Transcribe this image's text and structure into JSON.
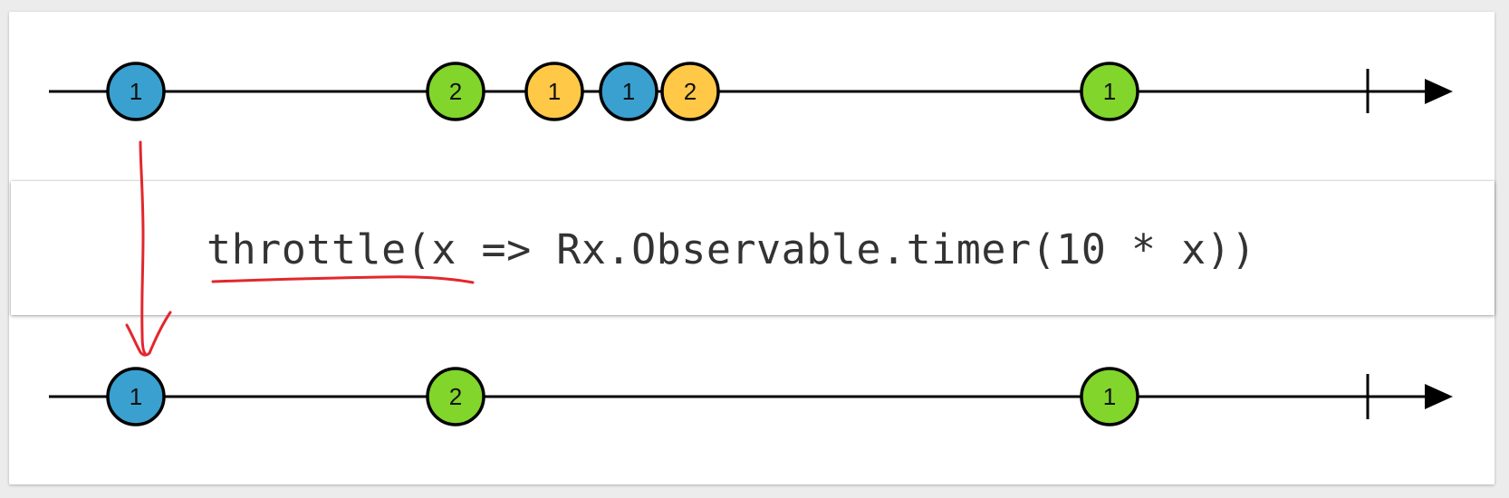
{
  "operator": {
    "text": "throttle(x => Rx.Observable.timer(10 * x))"
  },
  "colors": {
    "blue": "#3aa0d0",
    "green": "#82d52b",
    "yellow": "#ffc847",
    "line": "#000000",
    "annotation": "#e2272d"
  },
  "input_timeline": {
    "marbles": [
      {
        "label": "1",
        "color": "blue"
      },
      {
        "label": "2",
        "color": "green"
      },
      {
        "label": "1",
        "color": "yellow"
      },
      {
        "label": "1",
        "color": "blue"
      },
      {
        "label": "2",
        "color": "yellow"
      },
      {
        "label": "1",
        "color": "green"
      }
    ]
  },
  "output_timeline": {
    "marbles": [
      {
        "label": "1",
        "color": "blue"
      },
      {
        "label": "2",
        "color": "green"
      },
      {
        "label": "1",
        "color": "green"
      }
    ]
  }
}
